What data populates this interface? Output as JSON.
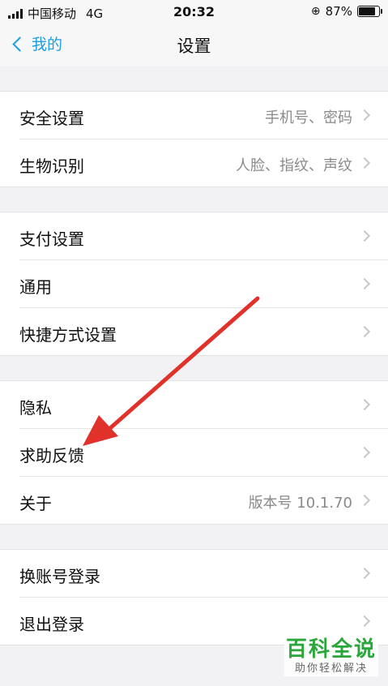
{
  "status_bar": {
    "carrier": "中国移动",
    "network": "4G",
    "time": "20:32",
    "battery": "87%",
    "battery_level": 0.87
  },
  "nav": {
    "back_label": "我的",
    "title": "设置"
  },
  "groups": [
    {
      "items": [
        {
          "label": "安全设置",
          "value": "手机号、密码"
        },
        {
          "label": "生物识别",
          "value": "人脸、指纹、声纹"
        }
      ]
    },
    {
      "items": [
        {
          "label": "支付设置",
          "value": ""
        },
        {
          "label": "通用",
          "value": ""
        },
        {
          "label": "快捷方式设置",
          "value": ""
        }
      ]
    },
    {
      "items": [
        {
          "label": "隐私",
          "value": ""
        },
        {
          "label": "求助反馈",
          "value": ""
        },
        {
          "label": "关于",
          "value": "版本号 10.1.70"
        }
      ]
    },
    {
      "items": [
        {
          "label": "换账号登录",
          "value": ""
        },
        {
          "label": "退出登录",
          "value": ""
        }
      ]
    }
  ],
  "watermark": {
    "main": "百科全说",
    "sub": "助你轻松解决"
  },
  "colors": {
    "accent": "#1e9de0",
    "annotation_arrow": "#e0312b",
    "watermark": "#2aa63a"
  }
}
